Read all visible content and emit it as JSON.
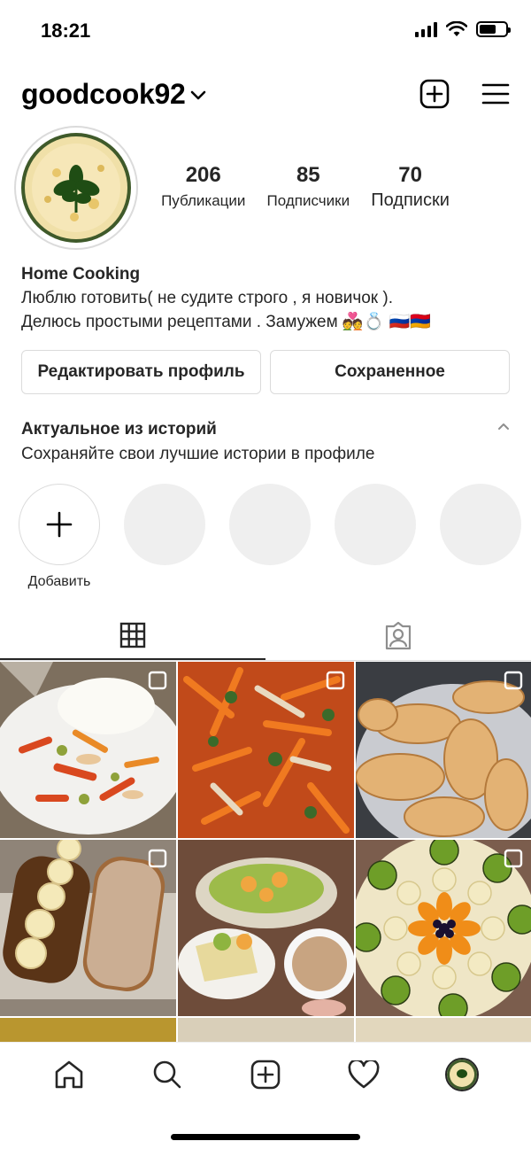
{
  "status": {
    "time": "18:21"
  },
  "header": {
    "username": "goodcook92"
  },
  "profile": {
    "stats": [
      {
        "num": "206",
        "label": "Публикации"
      },
      {
        "num": "85",
        "label": "Подписчики"
      },
      {
        "num": "70",
        "label": "Подписки"
      }
    ],
    "name": "Home Cooking",
    "bio_line1": "Люблю готовить( не судите строго , я новичок ).",
    "bio_line2": "Делюсь простыми рецептами . Замужем 💑💍 🇷🇺🇦🇲"
  },
  "buttons": {
    "edit": "Редактировать профиль",
    "saved": "Сохраненное"
  },
  "highlights": {
    "title": "Актуальное из историй",
    "subtitle": "Сохраняйте свои лучшие истории в профиле",
    "add_label": "Добавить"
  },
  "colors": {
    "text": "#262626",
    "border": "#dbdbdb",
    "placeholder": "#efefef"
  }
}
